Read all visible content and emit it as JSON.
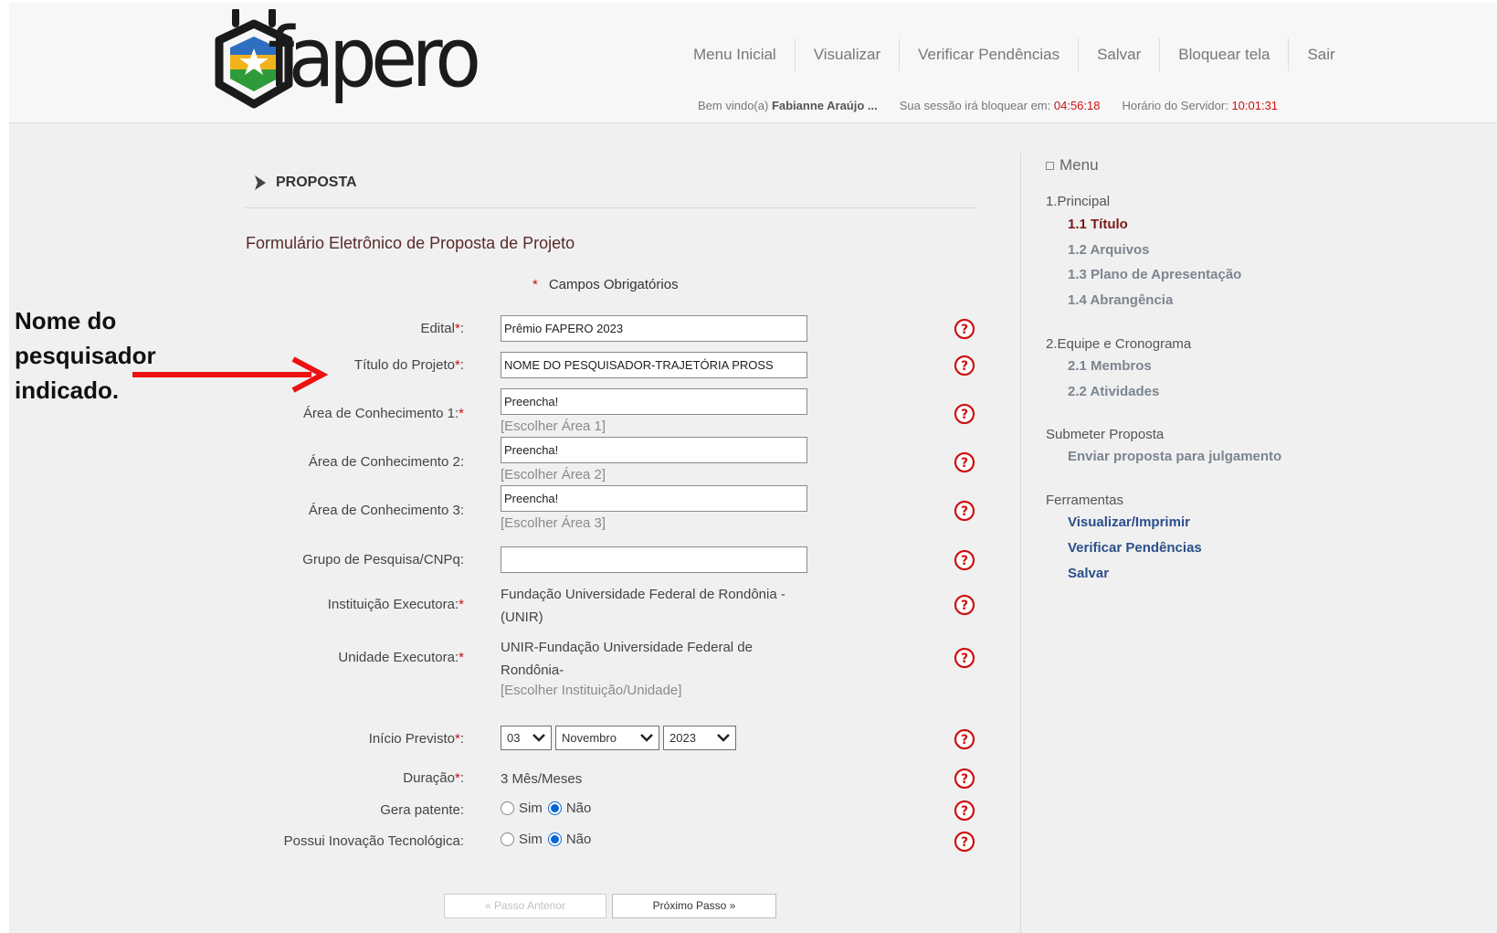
{
  "nav": {
    "items": [
      "Menu Inicial",
      "Visualizar",
      "Verificar Pendências",
      "Salvar",
      "Bloquear tela",
      "Sair"
    ]
  },
  "session": {
    "welcome_prefix": "Bem vindo(a)",
    "user_name": "Fabianne Araújo ...",
    "lock_label": "Sua sessão irá bloquear em:",
    "lock_time": "04:56:18",
    "server_label": "Horário do Servidor:",
    "server_time": "10:01:31"
  },
  "logo": {
    "text": "fapero"
  },
  "breadcrumb": "PROPOSTA",
  "form": {
    "title": "Formulário Eletrônico de Proposta de Projeto",
    "required_note": "Campos Obrigatórios",
    "star": "*",
    "fields": {
      "edital": {
        "label": "Edital",
        "value": "Prêmio FAPERO 2023"
      },
      "titulo": {
        "label": "Título do Projeto",
        "value": "NOME DO PESQUISADOR-TRAJETÓRIA PROSS"
      },
      "area1": {
        "label": "Área de Conhecimento 1:",
        "value": "Preencha!",
        "link": "[Escolher Área 1]"
      },
      "area2": {
        "label": "Área de Conhecimento 2:",
        "value": "Preencha!",
        "link": "[Escolher Área 2]"
      },
      "area3": {
        "label": "Área de Conhecimento 3:",
        "value": "Preencha!",
        "link": "[Escolher Área 3]"
      },
      "grupo": {
        "label": "Grupo de Pesquisa/CNPq:",
        "value": ""
      },
      "instituicao": {
        "label": "Instituição Executora:",
        "value": "Fundação Universidade Federal de Rondônia - (UNIR)"
      },
      "unidade": {
        "label": "Unidade Executora:",
        "value": "UNIR-Fundação Universidade Federal de Rondônia-",
        "link": "[Escolher Instituição/Unidade]"
      },
      "inicio": {
        "label": "Início Previsto",
        "day": "03",
        "month": "Novembro",
        "year": "2023"
      },
      "duracao": {
        "label": "Duração",
        "value": "3 Mês/Meses"
      },
      "patente": {
        "label": "Gera patente:",
        "opt_yes": "Sim",
        "opt_no": "Não",
        "selected": "Não"
      },
      "inovacao": {
        "label": "Possui Inovação Tecnológica:",
        "opt_yes": "Sim",
        "opt_no": "Não",
        "selected": "Não"
      }
    },
    "buttons": {
      "prev": "« Passo Anterior",
      "next": "Próximo Passo »"
    }
  },
  "sidebar": {
    "title": "Menu",
    "sections": {
      "principal": {
        "heading": "1.Principal",
        "items": [
          "1.1 Título",
          "1.2 Arquivos",
          "1.3 Plano de Apresentação",
          "1.4 Abrangência"
        ]
      },
      "equipe": {
        "heading": "2.Equipe e Cronograma",
        "items": [
          "2.1 Membros",
          "2.2 Atividades"
        ]
      },
      "submeter": {
        "heading": "Submeter Proposta",
        "items": [
          "Enviar proposta para julgamento"
        ]
      },
      "ferramentas": {
        "heading": "Ferramentas",
        "items": [
          "Visualizar/Imprimir",
          "Verificar Pendências",
          "Salvar"
        ]
      }
    },
    "active_item": "1.1 Título"
  },
  "annotation": {
    "lines": [
      "Nome do",
      "pesquisador",
      "indicado."
    ]
  },
  "colors": {
    "accent_red": "#cc1111",
    "arrow_red": "#ee1111",
    "title_maroon": "#5a2b2b",
    "tool_blue": "#2b4f8a",
    "radio_blue": "#0a64d6"
  }
}
